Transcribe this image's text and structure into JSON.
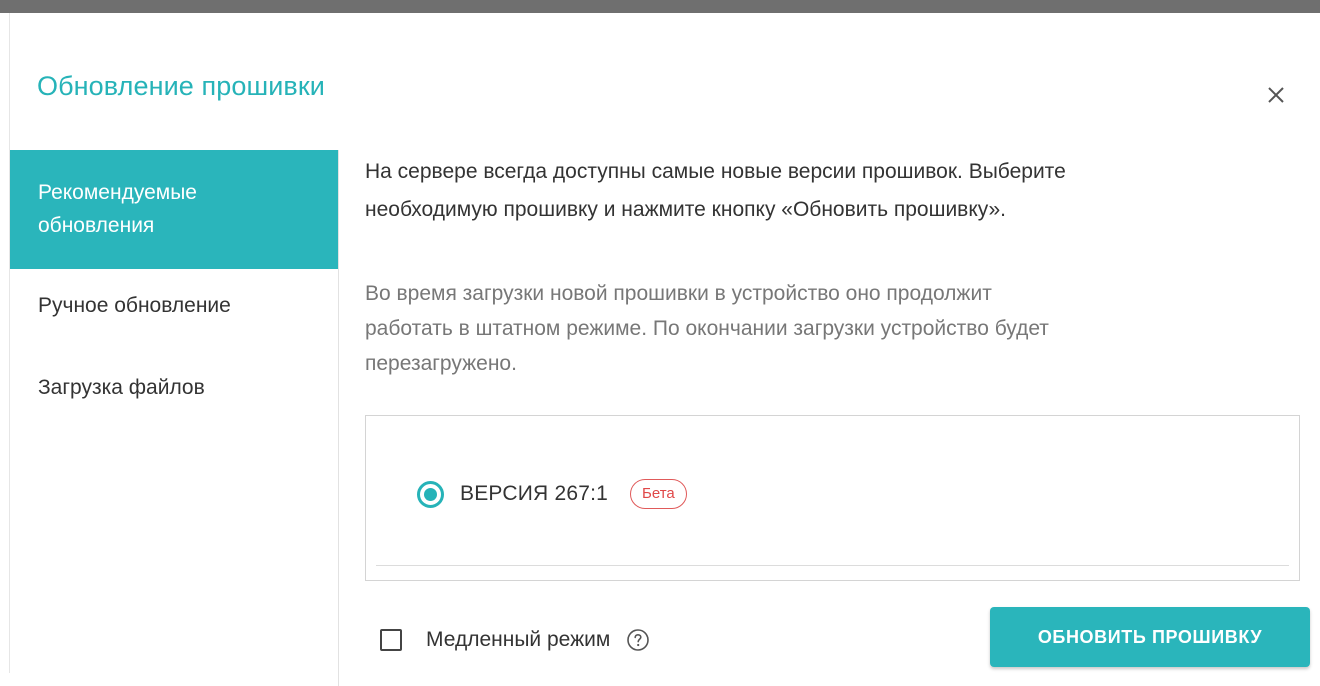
{
  "dialog": {
    "title": "Обновление прошивки",
    "close_icon": "close-icon"
  },
  "sidebar": {
    "items": [
      {
        "label_line1": "Рекомендуемые",
        "label_line2": "обновления",
        "active": true
      },
      {
        "label": "Ручное обновление",
        "active": false
      },
      {
        "label": "Загрузка файлов",
        "active": false
      }
    ]
  },
  "content": {
    "intro_line1": "На сервере всегда доступны самые новые версии прошивок. Выберите",
    "intro_line2": "необходимую прошивку и нажмите кнопку «Обновить прошивку».",
    "note_line1": "Во время загрузки новой прошивки в устройство оно продолжит",
    "note_line2": "работать в штатном режиме. По окончании загрузки устройство будет",
    "note_line3": "перезагружено.",
    "versions": [
      {
        "label": "ВЕРСИЯ 267:1",
        "badge": "Бета",
        "selected": true
      }
    ],
    "slow_mode": {
      "label": "Медленный режим",
      "checked": false,
      "help_icon": "help-circle-icon"
    },
    "update_button": "ОБНОВИТЬ ПРОШИВКУ"
  },
  "colors": {
    "accent": "#2ab5bb",
    "title": "#26b3b8",
    "badge": "#e04848",
    "text": "#333333",
    "muted_text": "#777777"
  }
}
